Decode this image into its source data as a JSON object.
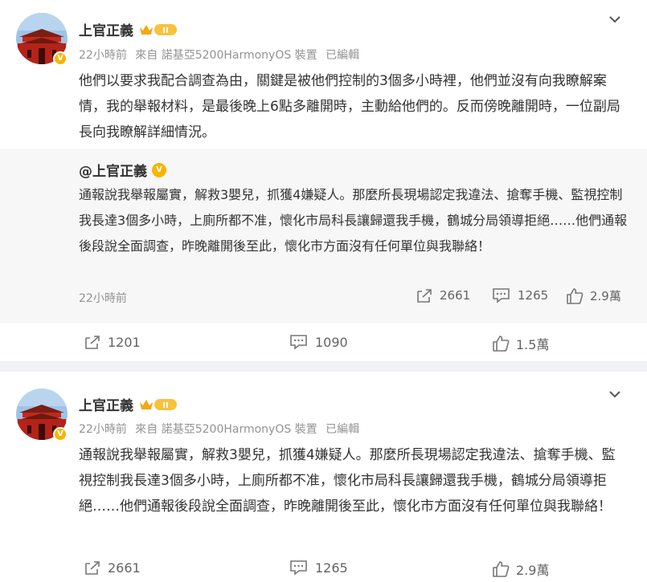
{
  "posts": [
    {
      "author": "上官正義",
      "meta": {
        "time": "22小時前",
        "source": "來自 諾基亞5200HarmonyOS 裝置",
        "edited": "已編輯"
      },
      "text": "他們以要求我配合調查為由，關鍵是被他們控制的3個多小時裡，他們並沒有向我瞭解案情，我的舉報材料，是最後晚上6點多離開時，主動給他們的。反而傍晚離開時，一位副局長向我瞭解詳細情況。",
      "repost": {
        "author": "@上官正義",
        "text": "通報說我舉報屬實，解救3嬰兒，抓獲4嫌疑人。那麼所長現場認定我違法、搶奪手機、監視控制我長達3個多小時，上廁所都不准，懷化市局科長讓歸還我手機，鶴城分局領導拒絕……他們通報後段說全面調查，昨晚離開後至此，懷化市方面沒有任何單位與我聯絡！",
        "time": "22小時前",
        "repost_count": "2661",
        "comment_count": "1265",
        "like_count": "2.9萬"
      },
      "repost_count": "1201",
      "comment_count": "1090",
      "like_count": "1.5萬"
    },
    {
      "author": "上官正義",
      "meta": {
        "time": "22小時前",
        "source": "來自 諾基亞5200HarmonyOS 裝置",
        "edited": "已編輯"
      },
      "text": "通報說我舉報屬實，解救3嬰兒，抓獲4嫌疑人。那麼所長現場認定我違法、搶奪手機、監視控制我長達3個多小時，上廁所都不准，懷化市局科長讓歸還我手機，鶴城分局領導拒絕……他們通報後段說全面調查，昨晚離開後至此，懷化市方面沒有任何單位與我聯絡！",
      "repost_count": "2661",
      "comment_count": "1265",
      "like_count": "2.9萬"
    }
  ],
  "badge_letter": "V",
  "level_badge": "II"
}
